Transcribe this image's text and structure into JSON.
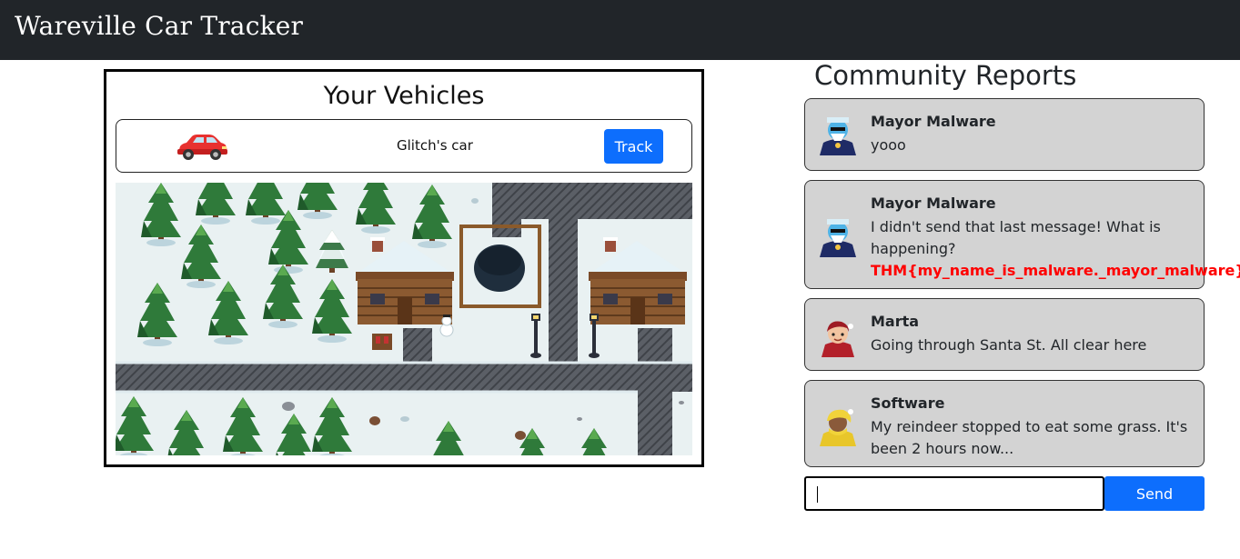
{
  "app": {
    "title": "Wareville Car Tracker"
  },
  "vehicles": {
    "heading": "Your Vehicles",
    "items": [
      {
        "icon": "red-car-icon",
        "name": "Glitch's car",
        "action_label": "Track"
      }
    ]
  },
  "map": {
    "icon": "snowy-village-map"
  },
  "community": {
    "heading": "Community Reports",
    "reports": [
      {
        "author": "Mayor Malware",
        "avatar": "mayor-malware-avatar",
        "text": "yooo",
        "flag": ""
      },
      {
        "author": "Mayor Malware",
        "avatar": "mayor-malware-avatar",
        "text": "I didn't send that last message! What is happening?",
        "flag": "THM{my_name_is_malware._mayor_malware}"
      },
      {
        "author": "Marta",
        "avatar": "marta-avatar",
        "text": "Going through Santa St. All clear here",
        "flag": ""
      },
      {
        "author": "Software",
        "avatar": "software-avatar",
        "text": "My reindeer stopped to eat some grass. It's been 2 hours now...",
        "flag": ""
      }
    ],
    "input_value": "",
    "send_label": "Send"
  },
  "colors": {
    "navbar": "#212529",
    "primary": "#0d6efd",
    "report_bg": "#d3d3d3",
    "flag": "#ff0000"
  }
}
